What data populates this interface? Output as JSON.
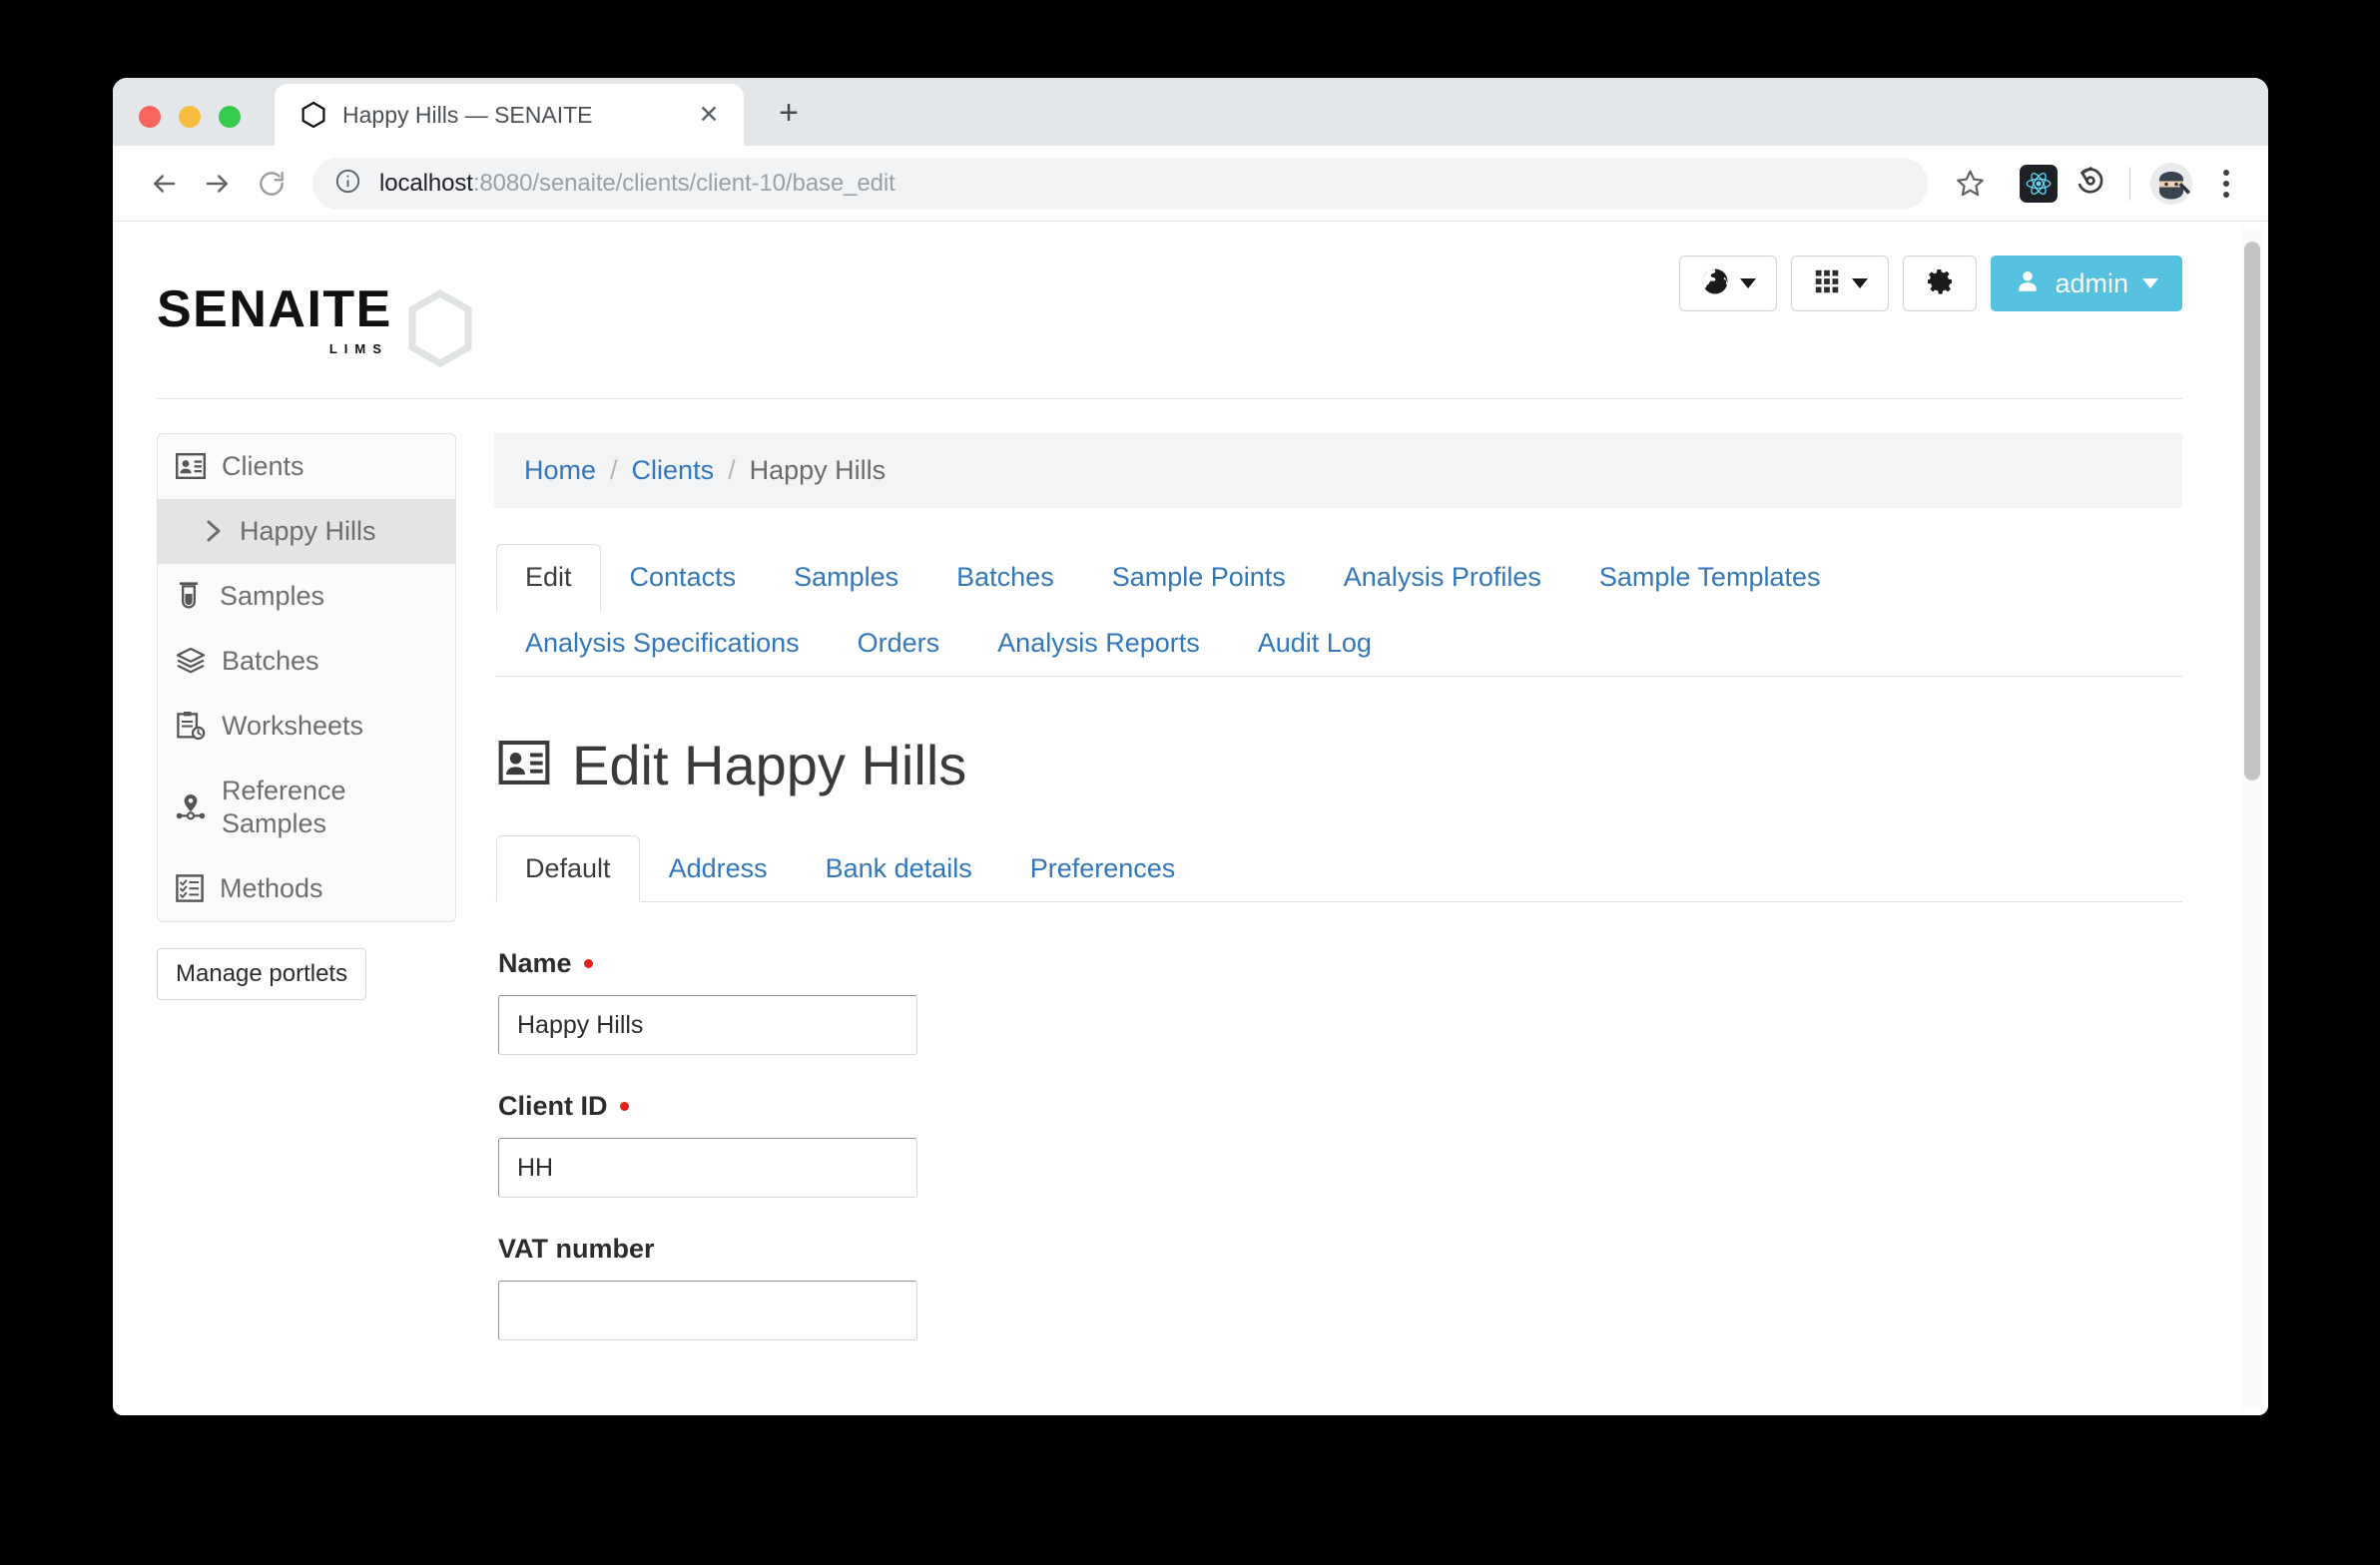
{
  "browser": {
    "tab": {
      "title": "Happy Hills — SENAITE",
      "favicon_icon": "hexagon-icon",
      "close_icon": "close-icon"
    },
    "new_tab_label": "+",
    "nav": {
      "back_icon": "arrow-left-icon",
      "forward_icon": "arrow-right-icon",
      "reload_icon": "reload-icon"
    },
    "omnibox": {
      "info_icon": "info-circle-icon",
      "url": "localhost:8080/senaite/clients/client-10/base_edit",
      "url_host": "localhost",
      "url_path": ":8080/senaite/clients/client-10/base_edit"
    },
    "star_icon": "star-icon",
    "extensions": [
      {
        "icon": "react-devtools-icon"
      },
      {
        "icon": "reload-extension-icon"
      }
    ],
    "profile_icon": "ninja-avatar-icon",
    "menu_icon": "three-dot-menu-icon"
  },
  "header": {
    "logo_wordmark": "SENAITE",
    "logo_subtitle": "LIMS",
    "logo_hex_icon": "hexagon-outline-icon",
    "tools": [
      {
        "name": "language-selector",
        "icon": "globe-icon",
        "has_caret": true
      },
      {
        "name": "apps-menu",
        "icon": "grid-icon",
        "has_caret": true
      },
      {
        "name": "settings-button",
        "icon": "gear-icon",
        "has_caret": false
      }
    ],
    "admin": {
      "label": "admin",
      "icon": "user-icon",
      "color": "#57c1e0"
    }
  },
  "sidebar": {
    "items": [
      {
        "label": "Clients",
        "icon": "id-card-icon",
        "active": false,
        "sub": false
      },
      {
        "label": "Happy Hills",
        "icon": "chevron-right-icon",
        "active": true,
        "sub": true
      },
      {
        "label": "Samples",
        "icon": "test-tube-icon",
        "active": false,
        "sub": false
      },
      {
        "label": "Batches",
        "icon": "layers-icon",
        "active": false,
        "sub": false
      },
      {
        "label": "Worksheets",
        "icon": "clipboard-clock-icon",
        "active": false,
        "sub": false
      },
      {
        "label": "Reference Samples",
        "icon": "map-pin-icon",
        "active": false,
        "sub": false
      },
      {
        "label": "Methods",
        "icon": "checklist-icon",
        "active": false,
        "sub": false
      }
    ],
    "manage_portlets_label": "Manage portlets"
  },
  "breadcrumb": {
    "items": [
      {
        "label": "Home",
        "link": true
      },
      {
        "label": "Clients",
        "link": true
      },
      {
        "label": "Happy Hills",
        "link": false
      }
    ],
    "separator": "/"
  },
  "content_tabs": {
    "row1": [
      {
        "label": "Edit",
        "active": true
      },
      {
        "label": "Contacts",
        "active": false
      },
      {
        "label": "Samples",
        "active": false
      },
      {
        "label": "Batches",
        "active": false
      },
      {
        "label": "Sample Points",
        "active": false
      },
      {
        "label": "Analysis Profiles",
        "active": false
      },
      {
        "label": "Sample Templates",
        "active": false
      }
    ],
    "row2": [
      {
        "label": "Analysis Specifications",
        "active": false
      },
      {
        "label": "Orders",
        "active": false
      },
      {
        "label": "Analysis Reports",
        "active": false
      },
      {
        "label": "Audit Log",
        "active": false
      }
    ]
  },
  "page": {
    "title": "Edit Happy Hills",
    "title_icon": "id-card-icon"
  },
  "form_tabs": [
    {
      "label": "Default",
      "active": true
    },
    {
      "label": "Address",
      "active": false
    },
    {
      "label": "Bank details",
      "active": false
    },
    {
      "label": "Preferences",
      "active": false
    }
  ],
  "form_fields": [
    {
      "label": "Name",
      "required": true,
      "value": "Happy Hills",
      "placeholder": ""
    },
    {
      "label": "Client ID",
      "required": true,
      "value": "HH",
      "placeholder": ""
    },
    {
      "label": "VAT number",
      "required": false,
      "value": "",
      "placeholder": ""
    }
  ],
  "colors": {
    "accent": "#57c1e0",
    "link": "#3277bb",
    "required": "#e2231a",
    "sidebar_active_bg": "#e4e4e4"
  }
}
